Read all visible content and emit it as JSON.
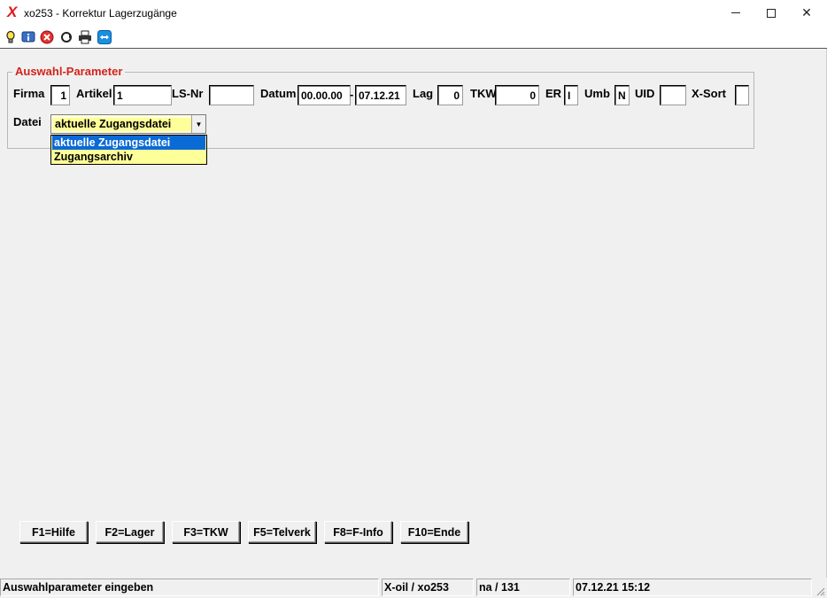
{
  "window": {
    "title": "xo253 - Korrektur Lagerzugänge",
    "app_icon_letter": "X"
  },
  "toolbar": {
    "icons": [
      "lightbulb-icon",
      "info-icon",
      "cancel-icon",
      "refresh-icon",
      "print-icon",
      "teamviewer-icon"
    ]
  },
  "params": {
    "group_title": "Auswahl-Parameter",
    "firma_label": "Firma",
    "firma_value": "1",
    "artikel_label": "Artikel",
    "artikel_value": "1",
    "lsnr_label": "LS-Nr",
    "lsnr_value": "",
    "datum_label": "Datum",
    "datum_from": "00.00.00",
    "datum_sep": "-",
    "datum_to": "07.12.21",
    "lag_label": "Lag",
    "lag_value": "0",
    "tkw_label": "TKW",
    "tkw_value": "0",
    "er_label": "ER",
    "er_value": "I",
    "umb_label": "Umb",
    "umb_value": "N",
    "uid_label": "UID",
    "uid_value": "",
    "xsort_label": "X-Sort",
    "xsort_value": "",
    "datei_label": "Datei",
    "datei_selected": "aktuelle Zugangsdatei",
    "datei_options": [
      "aktuelle Zugangsdatei",
      "Zugangsarchiv"
    ]
  },
  "function_buttons": [
    "F1=Hilfe",
    "F2=Lager",
    "F3=TKW",
    "F5=Telverk",
    "F8=F-Info",
    "F10=Ende"
  ],
  "statusbar": {
    "message": "Auswahlparameter eingeben",
    "program": "X-oil / xo253",
    "user": "na / 131",
    "datetime": "07.12.21 15:12"
  }
}
